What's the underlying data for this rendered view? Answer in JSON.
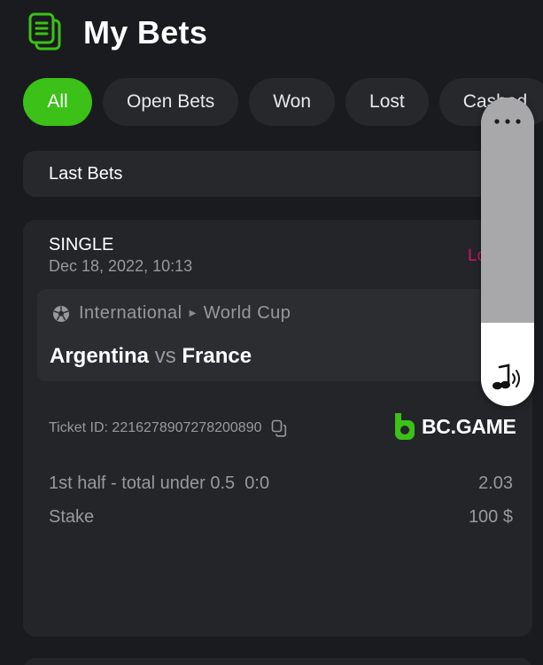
{
  "header": {
    "title": "My Bets",
    "icon": "bets-list-icon"
  },
  "tabs": [
    {
      "label": "All",
      "active": true
    },
    {
      "label": "Open Bets",
      "active": false
    },
    {
      "label": "Won",
      "active": false
    },
    {
      "label": "Lost",
      "active": false
    },
    {
      "label": "Cashed",
      "active": false
    }
  ],
  "section": {
    "label": "Last Bets"
  },
  "bet": {
    "type": "SINGLE",
    "date": "Dec 18, 2022, 10:13",
    "status": "Lost",
    "league": "International",
    "tournament": "World Cup",
    "team_home": "Argentina",
    "vs": "vs",
    "team_away": "France",
    "ticket_label": "Ticket ID:",
    "ticket_id": "2216278907278200890",
    "brand": "BC.GAME",
    "selection": "1st half - total under 0.5",
    "selection_score": "0:0",
    "odds": "2.03",
    "stake_label": "Stake",
    "stake_value": "100 $"
  },
  "colors": {
    "background": "#1a1b1e",
    "accent_green": "#3bc117",
    "lost_pink": "#d3106b",
    "muted_text": "#98999e"
  },
  "volume_overlay": {
    "level": 0.27
  }
}
